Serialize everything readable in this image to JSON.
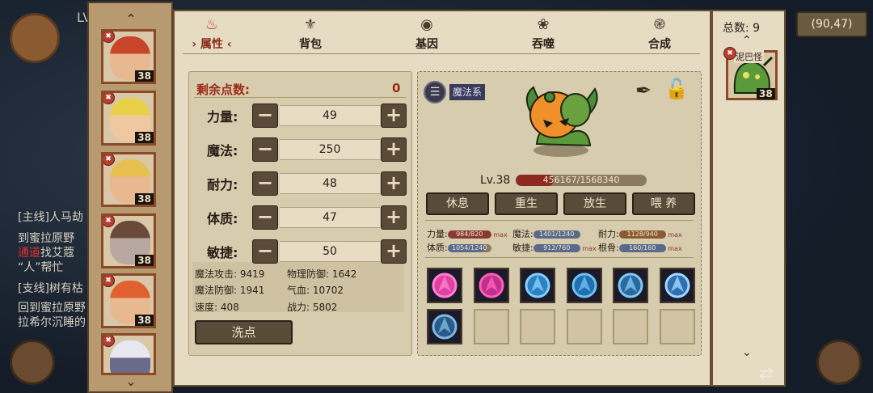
{
  "background": {
    "player_level_partial": "LV",
    "coords": "(90,47)",
    "quest_lines": [
      {
        "parts": [
          {
            "t": "[主线]人马劫",
            "c": ""
          }
        ]
      },
      {
        "parts": [
          {
            "t": "到蜜拉原野",
            "c": ""
          }
        ]
      },
      {
        "parts": [
          {
            "t": "通道",
            "c": "r"
          },
          {
            "t": "找艾蔻",
            "c": ""
          }
        ]
      },
      {
        "parts": [
          {
            "t": "“人”帮忙",
            "c": ""
          }
        ]
      },
      {
        "parts": [
          {
            "t": "[支线]树有枯",
            "c": ""
          }
        ]
      },
      {
        "parts": [
          {
            "t": "回到蜜拉原野",
            "c": ""
          }
        ]
      },
      {
        "parts": [
          {
            "t": "拉希尔沉睡的",
            "c": ""
          }
        ]
      }
    ]
  },
  "heroes": [
    {
      "level": "38",
      "hair": "#c8442a",
      "skin": "#e8b890"
    },
    {
      "level": "38",
      "hair": "#e8d048",
      "skin": "#f0c8a0"
    },
    {
      "level": "38",
      "hair": "#e8c050",
      "skin": "#e8b890"
    },
    {
      "level": "38",
      "hair": "#6a4a3a",
      "skin": "#b8a8a0"
    },
    {
      "level": "38",
      "hair": "#e06030",
      "skin": "#e8b890"
    },
    {
      "level": "",
      "hair": "#e8e8f0",
      "skin": "#6a6a8a"
    }
  ],
  "tabs": [
    {
      "label": "属性",
      "icon": "flame-icon",
      "active": true
    },
    {
      "label": "背包",
      "icon": "bag-icon",
      "active": false
    },
    {
      "label": "基因",
      "icon": "eye-icon",
      "active": false
    },
    {
      "label": "吞噬",
      "icon": "devour-icon",
      "active": false
    },
    {
      "label": "合成",
      "icon": "snail-icon",
      "active": false
    }
  ],
  "attributes": {
    "remaining_label": "剩余点数:",
    "remaining_value": "0",
    "stats": [
      {
        "label": "力量:",
        "value": "49"
      },
      {
        "label": "魔法:",
        "value": "250"
      },
      {
        "label": "耐力:",
        "value": "48"
      },
      {
        "label": "体质:",
        "value": "47"
      },
      {
        "label": "敏捷:",
        "value": "50"
      }
    ],
    "derived": [
      {
        "text": "魔法攻击: 9419"
      },
      {
        "text": "物理防御: 1642"
      },
      {
        "text": "魔法防御: 1941"
      },
      {
        "text": "气血: 10702"
      },
      {
        "text": "速度: 408"
      },
      {
        "text": "战力: 5802"
      }
    ],
    "reset_label": "洗点"
  },
  "creature": {
    "type_label": "魔法系",
    "level_label": "Lv.38",
    "hp_text": "456167/1568340",
    "hp_fraction": 0.29,
    "actions": [
      "休息",
      "重生",
      "放生",
      "喂  养"
    ],
    "aptitudes": [
      {
        "label": "力量:",
        "value": "984/820",
        "max": "max",
        "fill": 1.0,
        "color": "#8a3a30"
      },
      {
        "label": "魔法:",
        "value": "1401/1240",
        "max": "",
        "fill": 1.0,
        "color": "#5a6a8a"
      },
      {
        "label": "耐力:",
        "value": "1128/940",
        "max": "max",
        "fill": 1.0,
        "color": "#8a5a30"
      },
      {
        "label": "体质:",
        "value": "1054/1240",
        "max": "",
        "fill": 0.85,
        "color": "#5a6a8a"
      },
      {
        "label": "敏捷:",
        "value": "912/760",
        "max": "max",
        "fill": 1.0,
        "color": "#5a6a8a"
      },
      {
        "label": "根骨:",
        "value": "160/160",
        "max": "max",
        "fill": 1.0,
        "color": "#5a6a8a"
      }
    ],
    "skills": [
      {
        "name": "thorn-burst-skill",
        "c1": "#e040a0",
        "c2": "#ff80d0"
      },
      {
        "name": "pink-orb-skill",
        "c1": "#c03090",
        "c2": "#ff60b0"
      },
      {
        "name": "ice-shield-skill",
        "c1": "#3080c0",
        "c2": "#80d0ff"
      },
      {
        "name": "frost-slash-skill",
        "c1": "#2070b0",
        "c2": "#70c0f0"
      },
      {
        "name": "frost-rune-skill",
        "c1": "#2a6aa0",
        "c2": "#80c8f0"
      },
      {
        "name": "ice-shatter-skill",
        "c1": "#3070b0",
        "c2": "#a0d8ff"
      },
      {
        "name": "bubble-net-skill",
        "c1": "#2a5a8a",
        "c2": "#80b8e0"
      },
      {
        "name": "",
        "c1": "",
        "c2": ""
      },
      {
        "name": "",
        "c1": "",
        "c2": ""
      },
      {
        "name": "",
        "c1": "",
        "c2": ""
      },
      {
        "name": "",
        "c1": "",
        "c2": ""
      },
      {
        "name": "",
        "c1": "",
        "c2": ""
      }
    ]
  },
  "right": {
    "total_label": "总数: 9",
    "pet_name": "泥巴怪",
    "pet_level": "38"
  },
  "colors": {
    "panel": "#e6dcc4",
    "button": "#5a4a38",
    "accent_red": "#9a2a18"
  }
}
